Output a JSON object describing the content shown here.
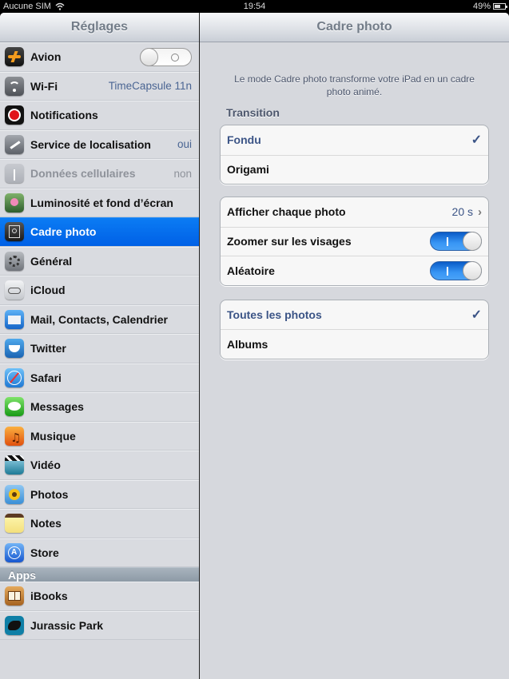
{
  "status_bar": {
    "carrier": "Aucune SIM",
    "time": "19:54",
    "battery": "49%",
    "battery_level": 0.49
  },
  "master": {
    "title": "Réglages",
    "items": [
      {
        "label": "Avion",
        "icon": "airplane-icon",
        "control": "switch",
        "switch_on": false
      },
      {
        "label": "Wi-Fi",
        "icon": "wifi-icon",
        "value": "TimeCapsule 11n"
      },
      {
        "label": "Notifications",
        "icon": "notifications-icon"
      },
      {
        "label": "Service de localisation",
        "icon": "location-icon",
        "value": "oui"
      },
      {
        "label": "Données cellulaires",
        "icon": "cellular-icon",
        "value": "non",
        "disabled": true
      },
      {
        "label": "Luminosité et fond d’écran",
        "icon": "brightness-wallpaper-icon"
      },
      {
        "label": "Cadre photo",
        "icon": "picture-frame-icon",
        "selected": true
      },
      {
        "label": "Général",
        "icon": "gear-icon"
      },
      {
        "label": "iCloud",
        "icon": "icloud-icon"
      },
      {
        "label": "Mail, Contacts, Calendrier",
        "icon": "mail-icon"
      },
      {
        "label": "Twitter",
        "icon": "twitter-icon"
      },
      {
        "label": "Safari",
        "icon": "safari-icon"
      },
      {
        "label": "Messages",
        "icon": "messages-icon"
      },
      {
        "label": "Musique",
        "icon": "music-icon"
      },
      {
        "label": "Vidéo",
        "icon": "video-icon"
      },
      {
        "label": "Photos",
        "icon": "photos-icon"
      },
      {
        "label": "Notes",
        "icon": "notes-icon"
      },
      {
        "label": "Store",
        "icon": "app-store-icon"
      }
    ],
    "apps_section_title": "Apps",
    "apps": [
      {
        "label": "iBooks",
        "icon": "ibooks-icon"
      },
      {
        "label": "Jurassic Park",
        "icon": "jurassic-park-icon"
      }
    ]
  },
  "detail": {
    "title": "Cadre photo",
    "description": "Le mode Cadre photo transforme votre iPad en un cadre photo animé.",
    "transition_title": "Transition",
    "transition_options": [
      {
        "label": "Fondu",
        "checked": true
      },
      {
        "label": "Origami",
        "checked": false
      }
    ],
    "settings": {
      "show_each_label": "Afficher chaque photo",
      "show_each_value": "20 s",
      "zoom_faces_label": "Zoomer sur les visages",
      "zoom_faces_on": true,
      "shuffle_label": "Aléatoire",
      "shuffle_on": true
    },
    "source_options": [
      {
        "label": "Toutes les photos",
        "checked": true
      },
      {
        "label": "Albums",
        "checked": false
      }
    ],
    "check_glyph": "✓",
    "chevron_glyph": "›"
  },
  "colors": {
    "selected_row": "#0b7cf4",
    "detail_accent": "#3b5486",
    "switch_on": "#3896f5"
  }
}
